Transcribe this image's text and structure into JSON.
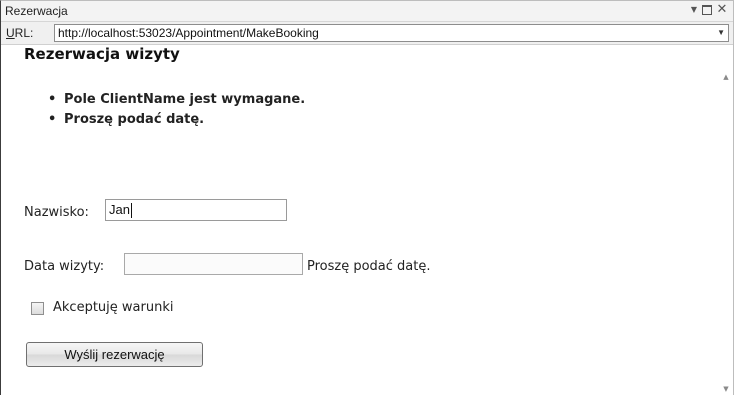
{
  "window": {
    "title": "Rezerwacja",
    "controls": {
      "dropdown_icon": "dropdown-arrow-icon",
      "maximize_icon": "maximize-icon",
      "close_icon": "close-icon"
    }
  },
  "urlbar": {
    "label_underlined": "U",
    "label_rest": "RL:",
    "value": "http://localhost:53023/Appointment/MakeBooking"
  },
  "page": {
    "heading": "Rezerwacja wizyty",
    "errors": [
      "Pole ClientName jest wymagane.",
      "Proszę podać datę."
    ],
    "name_label": "Nazwisko:",
    "name_value": "Jan",
    "date_label": "Data wizyty:",
    "date_value": "",
    "date_error": "Proszę podać datę.",
    "terms_label": "Akceptuję warunki",
    "terms_checked": false,
    "submit_label": "Wyślij rezerwację"
  }
}
